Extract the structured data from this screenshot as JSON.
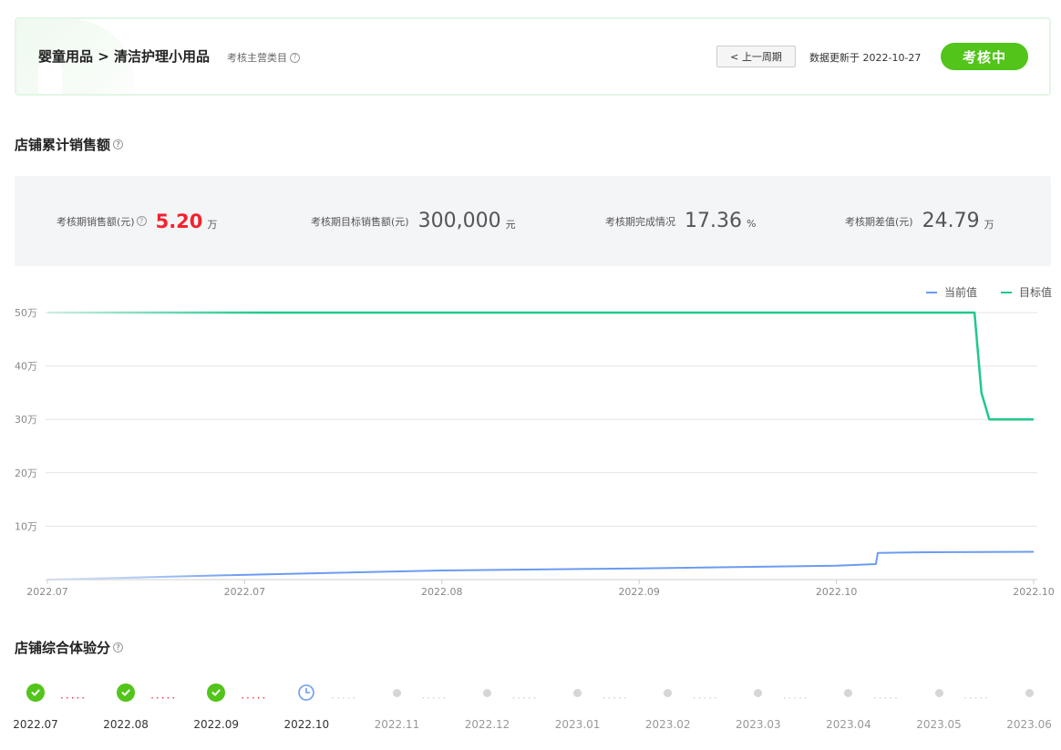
{
  "header": {
    "category_path": "婴童用品 > 清洁护理小用品",
    "category_hint": "考核主营类目",
    "prev_period_label": "< 上一周期",
    "update_text": "数据更新于 2022-10-27",
    "status": "考核中"
  },
  "sales_section": {
    "title": "店铺累计销售额",
    "metrics": [
      {
        "label": "考核期销售额(元)",
        "value": "5.20",
        "unit": "万",
        "has_help": true,
        "highlight": true
      },
      {
        "label": "考核期目标销售额(元)",
        "value": "300,000",
        "unit": "元",
        "has_help": false,
        "highlight": false
      },
      {
        "label": "考核期完成情况",
        "value": "17.36",
        "unit": "%",
        "has_help": false,
        "highlight": false
      },
      {
        "label": "考核期差值(元)",
        "value": "24.79",
        "unit": "万",
        "has_help": false,
        "highlight": false
      }
    ]
  },
  "chart_data": {
    "type": "line",
    "y_ticks": [
      "10万",
      "20万",
      "30万",
      "40万",
      "50万"
    ],
    "x_tick_labels": [
      "2022.07",
      "2022.07",
      "2022.08",
      "2022.09",
      "2022.10",
      "2022.10"
    ],
    "ylim": [
      0,
      500000
    ],
    "grid": true,
    "legend_placement": "top-right",
    "series": [
      {
        "name": "当前值",
        "color": "#6b9bf2",
        "points": [
          [
            0,
            0
          ],
          [
            0.18,
            8000
          ],
          [
            0.4,
            17000
          ],
          [
            0.6,
            21000
          ],
          [
            0.8,
            26000
          ],
          [
            0.84,
            29000
          ],
          [
            0.842,
            50000
          ],
          [
            0.88,
            51000
          ],
          [
            1.0,
            52000
          ]
        ]
      },
      {
        "name": "目标值",
        "color": "#1ec98a",
        "points": [
          [
            0,
            500000
          ],
          [
            0.94,
            500000
          ],
          [
            0.947,
            350000
          ],
          [
            0.955,
            300000
          ],
          [
            1.0,
            300000
          ]
        ]
      }
    ]
  },
  "experience_section": {
    "title": "店铺综合体验分",
    "timeline": [
      {
        "month": "2022.07",
        "state": "done"
      },
      {
        "month": "2022.08",
        "state": "done"
      },
      {
        "month": "2022.09",
        "state": "done"
      },
      {
        "month": "2022.10",
        "state": "current"
      },
      {
        "month": "2022.11",
        "state": "future"
      },
      {
        "month": "2022.12",
        "state": "future"
      },
      {
        "month": "2023.01",
        "state": "future"
      },
      {
        "month": "2023.02",
        "state": "future"
      },
      {
        "month": "2023.03",
        "state": "future"
      },
      {
        "month": "2023.04",
        "state": "future"
      },
      {
        "month": "2023.05",
        "state": "future"
      },
      {
        "month": "2023.06",
        "state": "future"
      }
    ],
    "colors": {
      "done": "#52c41a",
      "current": "#6b9bf2",
      "future": "#d6d6d6",
      "done_dots": "#f5222d"
    }
  }
}
